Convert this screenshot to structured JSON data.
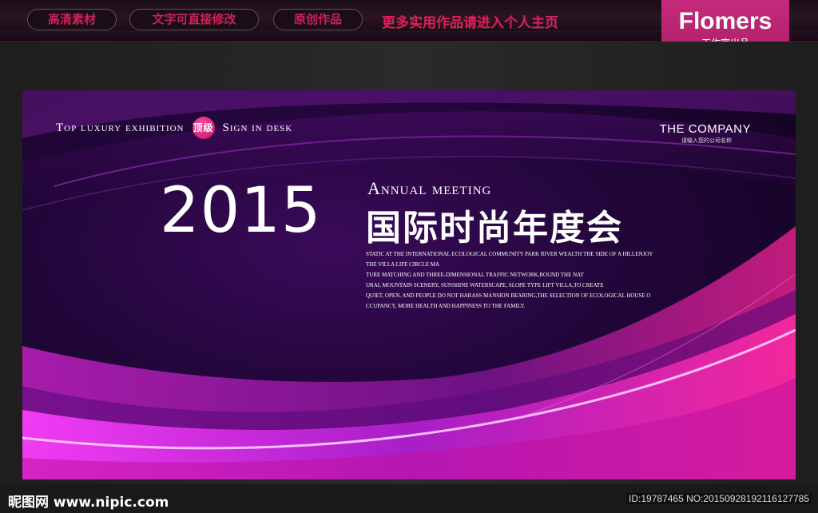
{
  "topbar": {
    "pills": [
      "高清素材",
      "文字可直接修改",
      "原创作品"
    ],
    "promo": "更多实用作品请进入个人主页",
    "brand": "Flomers",
    "brand_sub": "工作室出品"
  },
  "poster": {
    "tagline_before": "Top luxury exhibition",
    "seal": "顶级",
    "tagline_after": "Sign in desk",
    "company": "THE COMPANY",
    "company_sub": "请输入您的公司名称",
    "year": "2015",
    "annual": "Annual meeting",
    "cn_title": "国际时尚年度会",
    "desc_lines": [
      "STATIC AT THE INTERNATIONAL ECOLOGICAL COMMUNITY PARK RIVER WEALTH THE SIDE OF A HILLENJOY",
      "THE VILLA LIFE CIRCLE MA",
      "TURE MATCHING AND THREE-DIMENSIONAL TRAFFIC NETWORK,ROUND THE NAT",
      "URAL MOUNTAIN SCENERY, SUNSHINE WATERSCAPE, SLOPE TYPE LIFT VILLA,TO CREATE",
      "QUIET, OPEN, AND PEOPLE DO NOT HARASS MANSION BEARING,THE SELECTION OF ECOLOGICAL HOUSE O",
      "CCUPANCY, MORE HEALTH AND HAPPINESS TO THE FAMILY."
    ]
  },
  "watermark": {
    "left": "昵图网 www.nipic.com",
    "right": "ID:19787465 NO:20150928192116127785"
  },
  "colors": {
    "accent": "#d0205a",
    "badge": "#b8226e",
    "purple_dark": "#22063a",
    "magenta": "#e020c0"
  }
}
